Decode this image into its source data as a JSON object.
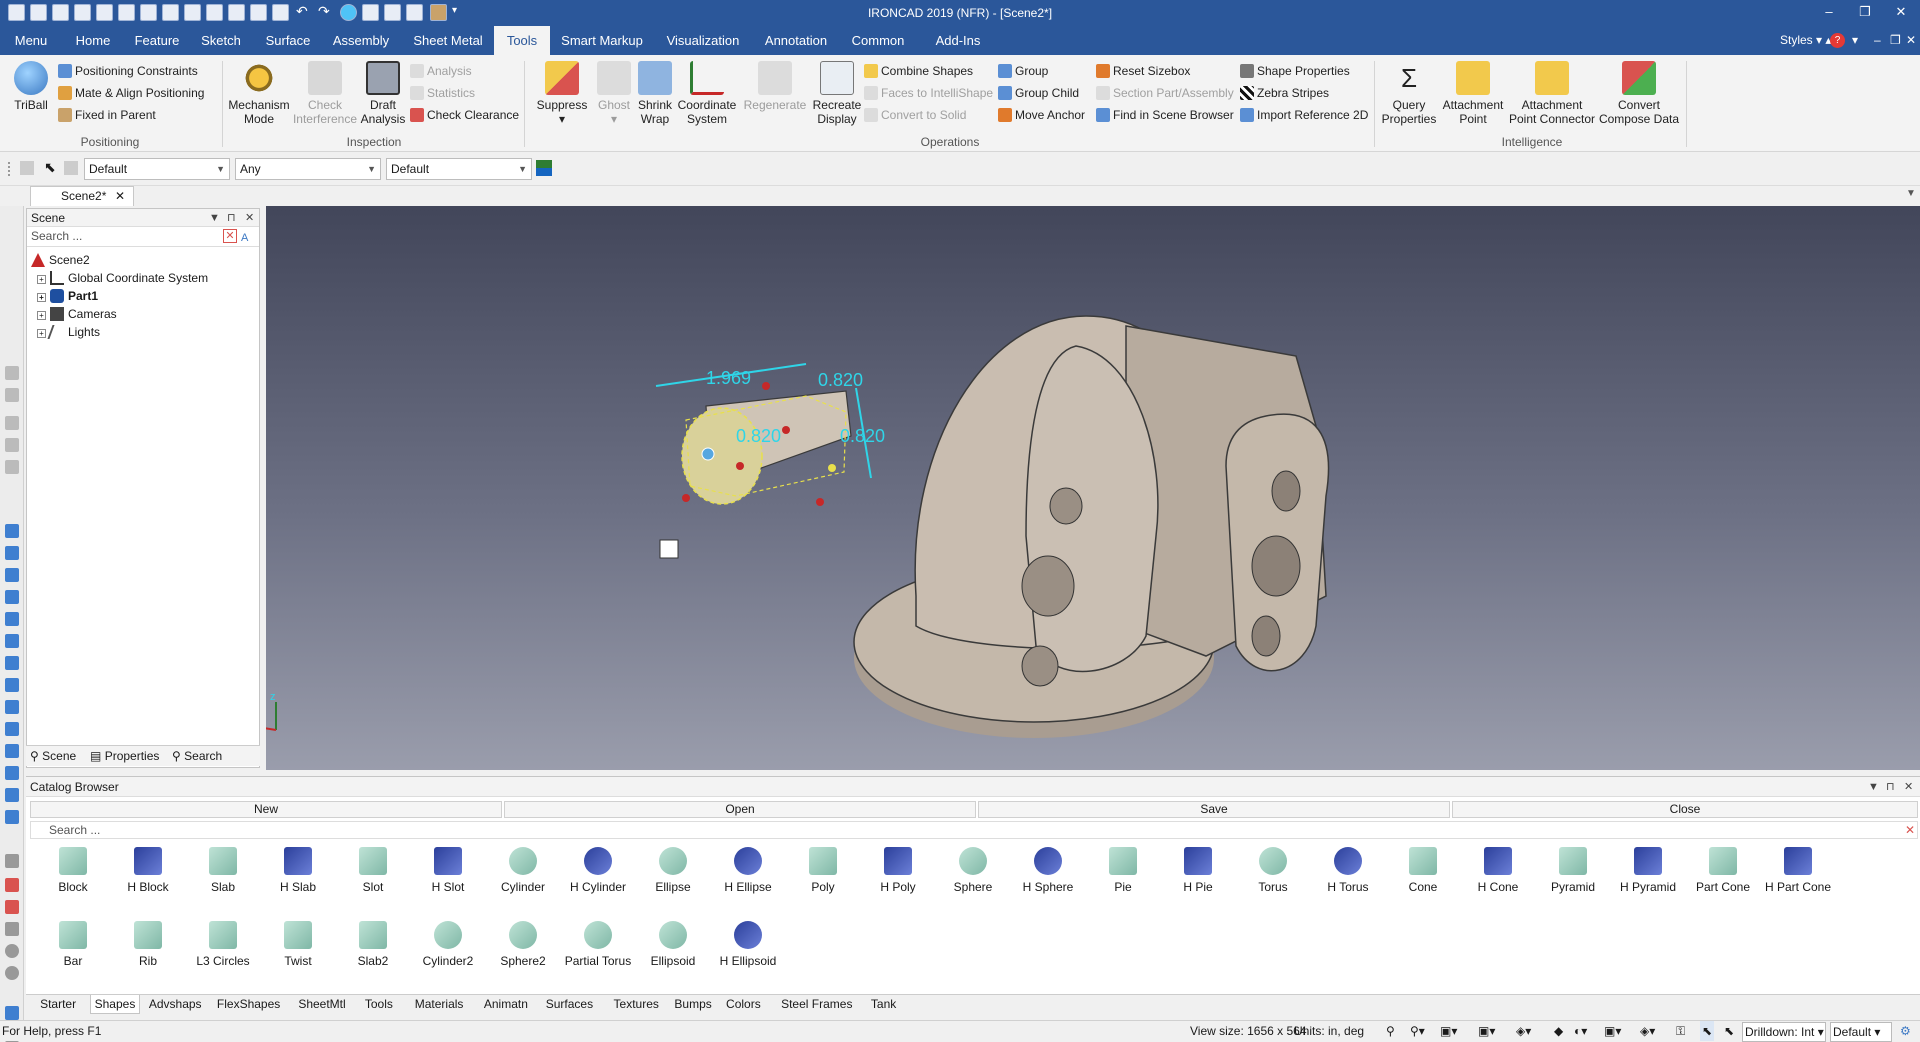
{
  "window": {
    "title": "IRONCAD 2019 (NFR) - [Scene2*]"
  },
  "tabs": [
    "Menu",
    "Home",
    "Feature",
    "Sketch",
    "Surface",
    "Assembly",
    "Sheet Metal",
    "Tools",
    "Smart Markup",
    "Visualization",
    "Annotation",
    "Common",
    "Add-Ins"
  ],
  "active_tab": "Tools",
  "styles_label": "Styles",
  "ribbon": {
    "triball": "TriBall",
    "positioning": [
      "Positioning Constraints",
      "Mate & Align Positioning",
      "Fixed in Parent"
    ],
    "positioning_group": "Positioning",
    "mechanism": [
      "Mechanism",
      "Mode"
    ],
    "check_interference": [
      "Check",
      "Interference"
    ],
    "draft_analysis": [
      "Draft",
      "Analysis"
    ],
    "inspection_small": [
      "Analysis",
      "Statistics",
      "Check Clearance"
    ],
    "inspection_group": "Inspection",
    "suppress": "Suppress",
    "ghost": "Ghost",
    "shrink_wrap": [
      "Shrink",
      "Wrap"
    ],
    "coordinate_system": [
      "Coordinate",
      "System"
    ],
    "regenerate": "Regenerate",
    "recreate_display": [
      "Recreate",
      "Display"
    ],
    "ops_col1": [
      "Combine Shapes",
      "Faces to IntelliShape",
      "Convert to Solid"
    ],
    "ops_col2": [
      "Group",
      "Group Child",
      "Move Anchor"
    ],
    "ops_col3": [
      "Reset Sizebox",
      "Section Part/Assembly",
      "Find in Scene Browser"
    ],
    "ops_col4": [
      "Shape Properties",
      "Zebra Stripes",
      "Import Reference 2D"
    ],
    "operations_group": "Operations",
    "query_properties": [
      "Query",
      "Properties"
    ],
    "attachment_point": [
      "Attachment",
      "Point"
    ],
    "attachment_point_connector": [
      "Attachment",
      "Point Connector"
    ],
    "convert_compose": [
      "Convert",
      "Compose Data"
    ],
    "intelligence_group": "Intelligence"
  },
  "toolbar": {
    "combo1": "Default",
    "combo2": "Any",
    "combo3": "Default"
  },
  "document_tab": "Scene2*",
  "scene_panel": {
    "title": "Scene",
    "search_placeholder": "Search ...",
    "root": "Scene2",
    "items": [
      "Global Coordinate System",
      "Part1",
      "Cameras",
      "Lights"
    ],
    "tabs": [
      "Scene",
      "Properties",
      "Search"
    ]
  },
  "viewport": {
    "dimensions": [
      "1.969",
      "0.820",
      "0.820",
      "0.820"
    ],
    "axis_label": "z"
  },
  "catalog": {
    "title": "Catalog Browser",
    "buttons": [
      "New",
      "Open",
      "Save",
      "Close"
    ],
    "search_placeholder": "Search ...",
    "shapes_row1": [
      "Block",
      "H Block",
      "Slab",
      "H Slab",
      "Slot",
      "H Slot",
      "Cylinder",
      "H Cylinder",
      "Ellipse",
      "H Ellipse",
      "Poly",
      "H Poly",
      "Sphere",
      "H Sphere",
      "Pie",
      "H Pie",
      "Torus",
      "H Torus",
      "Cone",
      "H Cone",
      "Pyramid",
      "H Pyramid",
      "Part Cone",
      "H Part Cone"
    ],
    "shapes_row2": [
      "Bar",
      "Rib",
      "L3 Circles",
      "Twist",
      "Slab2",
      "Cylinder2",
      "Sphere2",
      "Partial Torus",
      "Ellipsoid",
      "H Ellipsoid"
    ],
    "tabs": [
      "Starter",
      "Shapes",
      "Advshaps",
      "FlexShapes",
      "SheetMtl",
      "Tools",
      "Materials",
      "Animatn",
      "Surfaces",
      "Textures",
      "Bumps",
      "Colors",
      "Steel Frames",
      "Tank"
    ],
    "active_tab": "Shapes"
  },
  "status": {
    "help": "For Help, press F1",
    "view_size": "View size: 1656 x 564",
    "units": "Units: in, deg",
    "drilldown": "Drilldown: Int",
    "style": "Default"
  },
  "colors": {
    "brand": "#2b579a",
    "dimension": "#2fd5e8",
    "part": "#c4b8aa"
  }
}
